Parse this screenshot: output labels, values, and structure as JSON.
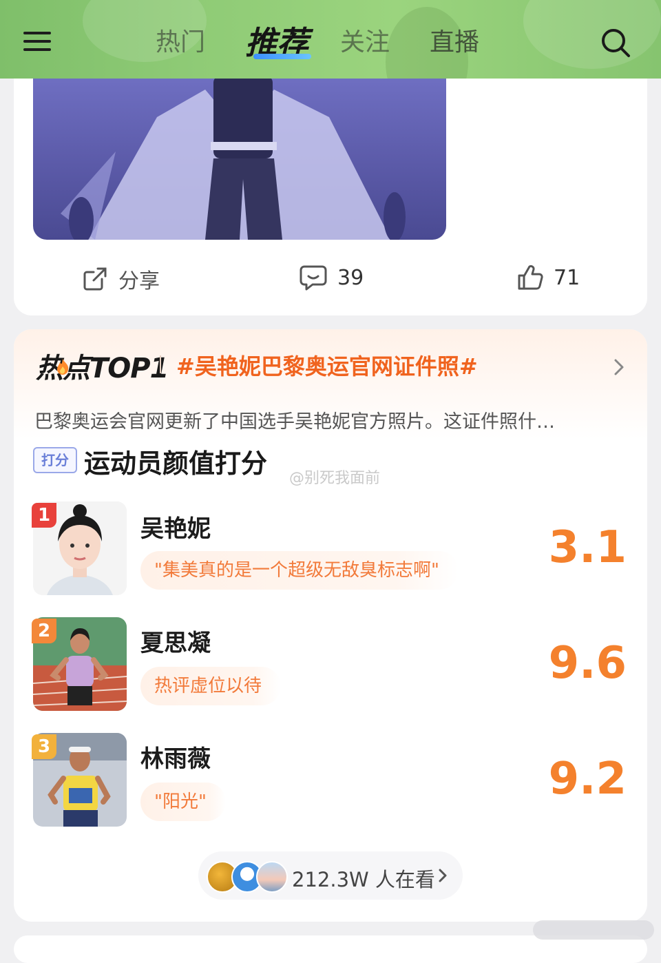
{
  "nav": {
    "tabs": [
      {
        "label": "热门",
        "active": false
      },
      {
        "label": "推荐",
        "active": true
      },
      {
        "label": "关注",
        "active": false
      },
      {
        "label": "直播",
        "active": false
      }
    ],
    "menu_icon": "hamburger-menu-icon",
    "search_icon": "search-icon"
  },
  "post": {
    "share_label": "分享",
    "comment_count": "39",
    "like_count": "71"
  },
  "hot": {
    "logo": "热点TOP1",
    "topic": "#吴艳妮巴黎奥运官网证件照#",
    "description": "巴黎奥运会官网更新了中国选手吴艳妮官方照片。这证件照什…",
    "badge": "打分",
    "title": "运动员颜值打分",
    "watermark": "@别死我面前",
    "athletes": [
      {
        "rank": "1",
        "name": "吴艳妮",
        "comment": "\"集美真的是一个超级无敌臭标志啊\"",
        "score": "3.1",
        "rank_color": "#e8413b"
      },
      {
        "rank": "2",
        "name": "夏思凝",
        "comment": "热评虚位以待",
        "score": "9.6",
        "rank_color": "#f3883a"
      },
      {
        "rank": "3",
        "name": "林雨薇",
        "comment": "\"阳光\"",
        "score": "9.2",
        "rank_color": "#f2b13c"
      }
    ],
    "viewers_text": "212.3W 人在看"
  },
  "colors": {
    "accent_orange": "#f4812d",
    "topic_orange": "#f0631e",
    "nav_green": "#8fcb76",
    "tab_underline_blue": "#3c8fff"
  }
}
